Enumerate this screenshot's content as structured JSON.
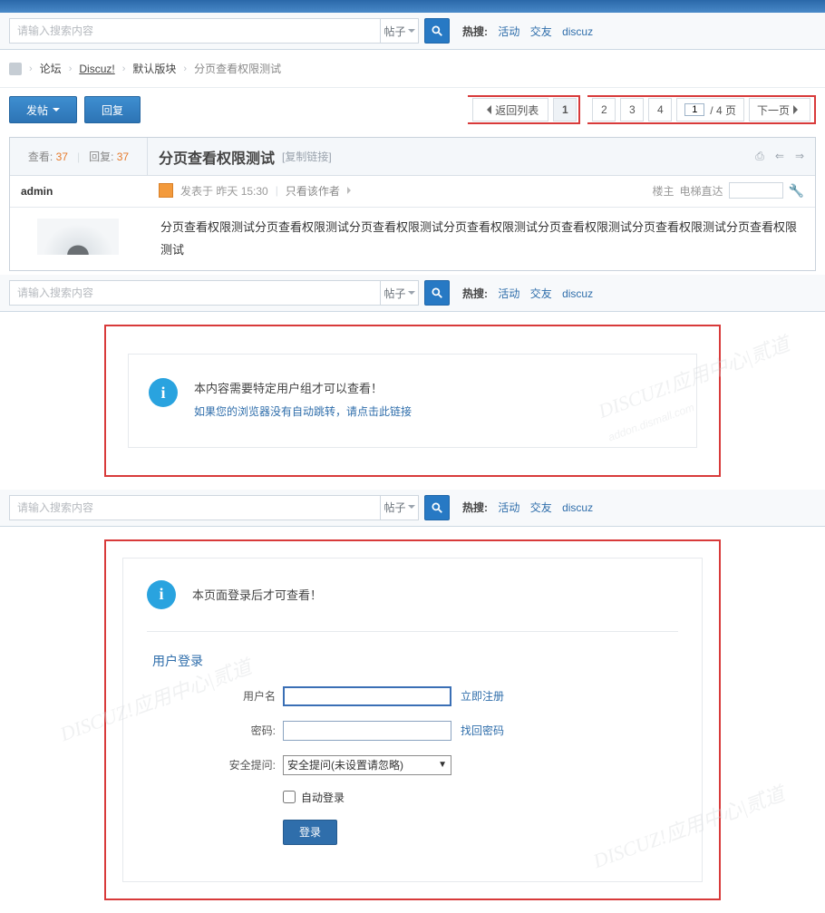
{
  "search": {
    "placeholder": "请输入搜索内容",
    "type": "帖子",
    "hot_label": "热搜:",
    "hot": [
      "活动",
      "交友",
      "discuz"
    ]
  },
  "breadcrumb": {
    "forum": "论坛",
    "board": "Discuz!",
    "section": "默认版块",
    "thread": "分页查看权限测试"
  },
  "actions": {
    "newpost": "发帖",
    "reply": "回复"
  },
  "pager": {
    "back": "返回列表",
    "pages": [
      "1",
      "2",
      "3",
      "4"
    ],
    "input": "1",
    "total_suffix": "/ 4 页",
    "next": "下一页"
  },
  "post": {
    "views_label": "查看:",
    "views": "37",
    "replies_label": "回复:",
    "replies": "37",
    "title": "分页查看权限测试",
    "copy": "[复制链接]",
    "author": "admin",
    "posttime_prefix": "发表于",
    "posttime": "昨天 15:30",
    "author_only": "只看该作者",
    "floor": "楼主",
    "elevator": "电梯直达",
    "body": "分页查看权限测试分页查看权限测试分页查看权限测试分页查看权限测试分页查看权限测试分页查看权限测试分页查看权限测试"
  },
  "box1": {
    "msg": "本内容需要特定用户组才可以查看！",
    "link": "如果您的浏览器没有自动跳转，请点击此链接"
  },
  "box2": {
    "msg": "本页面登录后才可查看！",
    "title": "用户登录",
    "user_label": "用户名",
    "pass_label": "密码:",
    "question_label": "安全提问:",
    "question_opt": "安全提问(未设置请忽略)",
    "register": "立即注册",
    "findpw": "找回密码",
    "auto": "自动登录",
    "submit": "登录"
  }
}
